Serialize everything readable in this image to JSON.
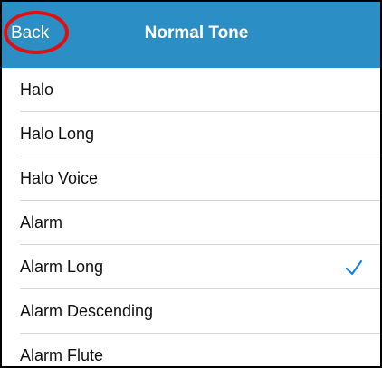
{
  "nav": {
    "back_label": "Back",
    "title": "Normal Tone"
  },
  "tones": [
    {
      "label": "Halo",
      "selected": false
    },
    {
      "label": "Halo Long",
      "selected": false
    },
    {
      "label": "Halo Voice",
      "selected": false
    },
    {
      "label": "Alarm",
      "selected": false
    },
    {
      "label": "Alarm Long",
      "selected": true
    },
    {
      "label": "Alarm Descending",
      "selected": false
    },
    {
      "label": "Alarm Flute",
      "selected": false
    }
  ],
  "colors": {
    "nav_background": "#2b8fc6",
    "accent": "#1a7ff0",
    "highlight": "#e01010"
  },
  "icons": {
    "selected": "checkmark-icon"
  }
}
